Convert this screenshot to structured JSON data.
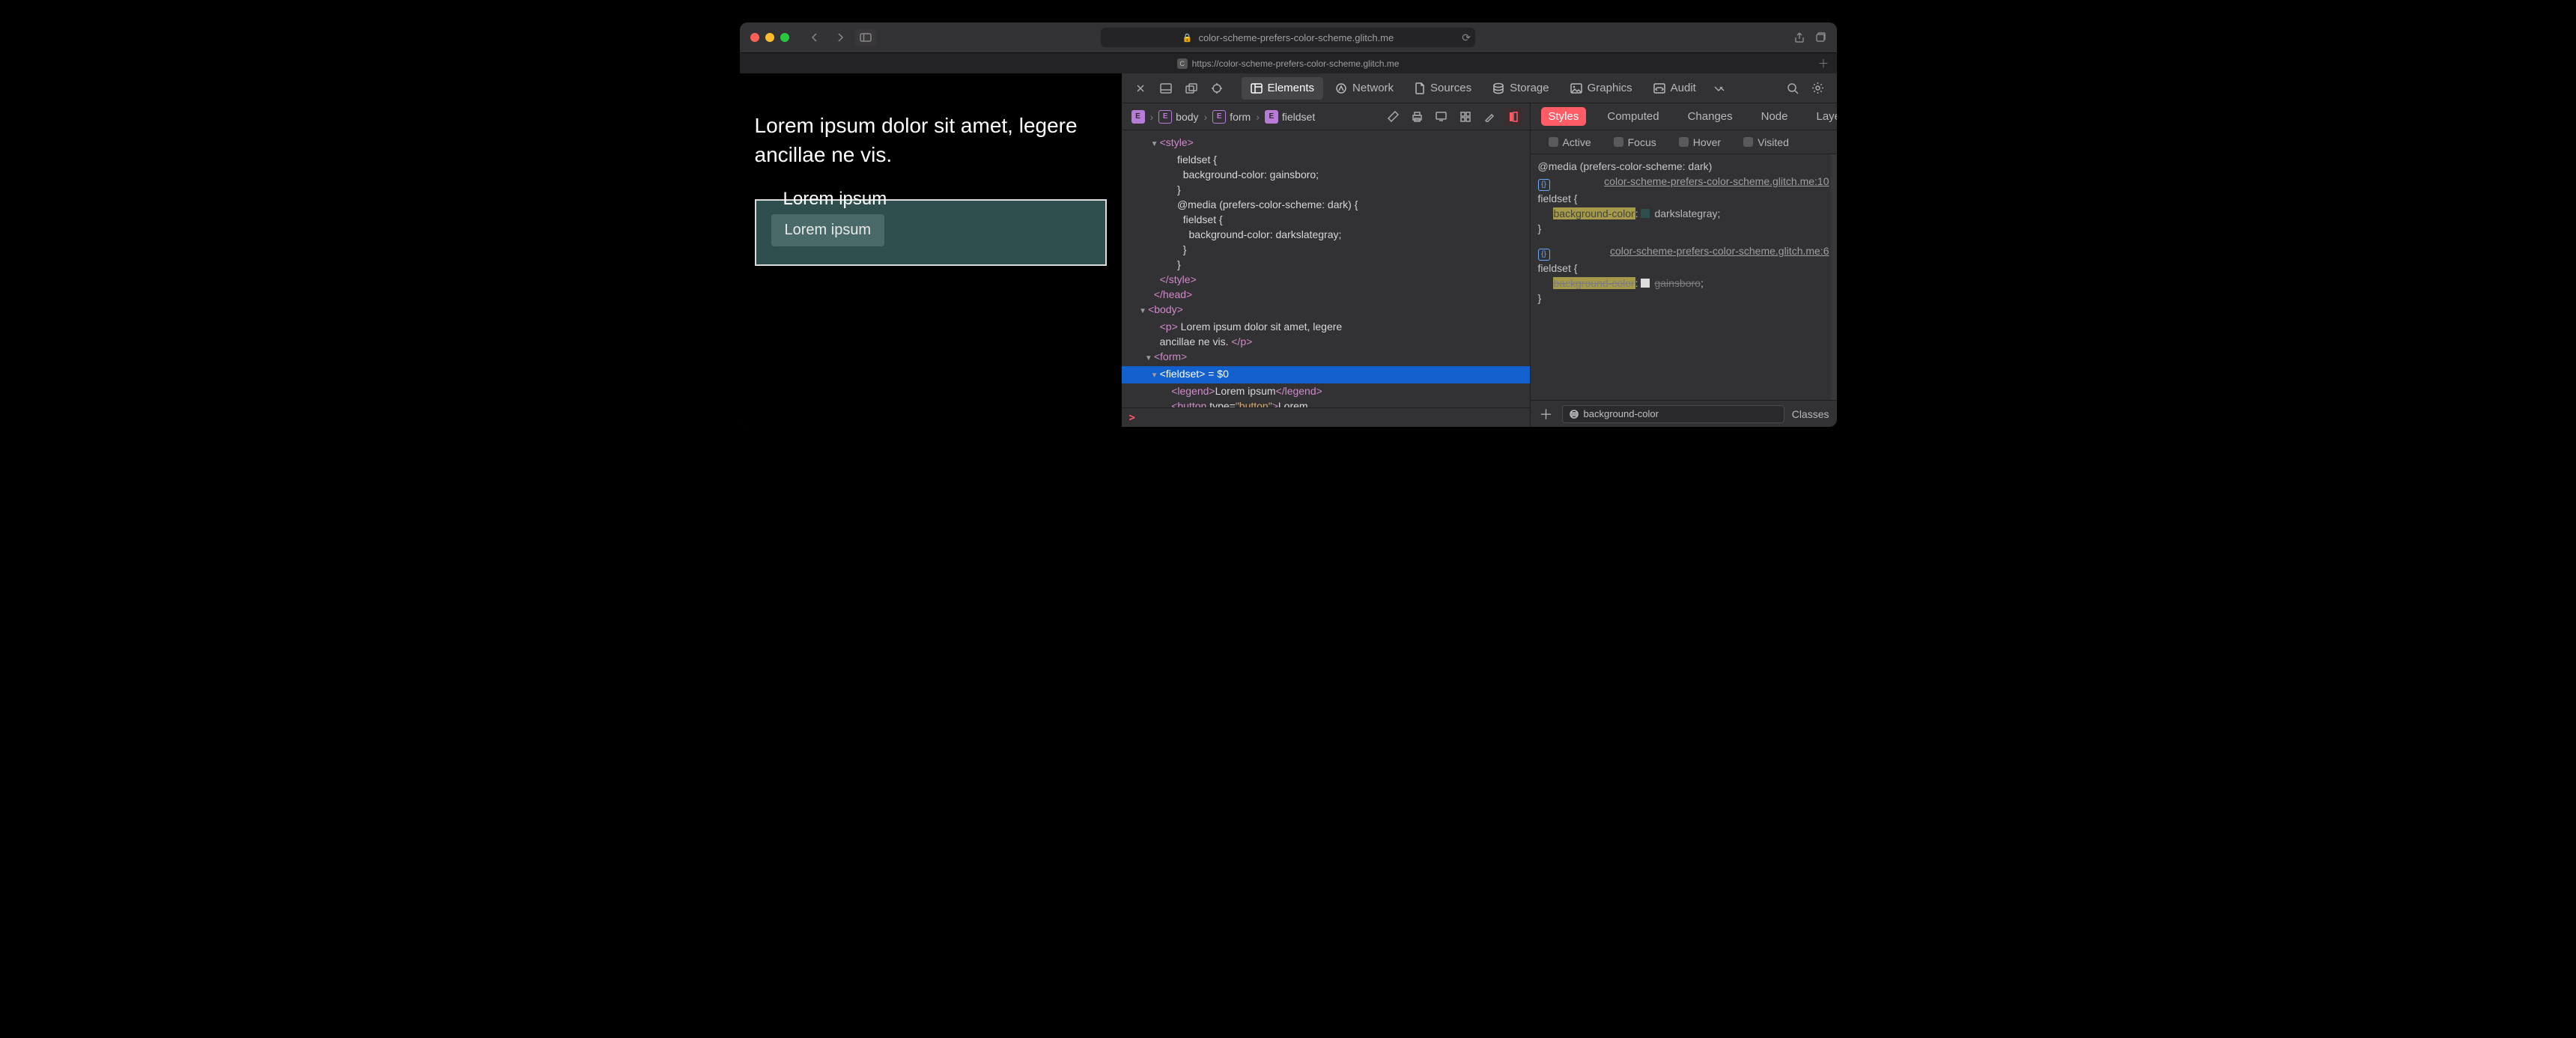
{
  "titlebar": {
    "address_host": "color-scheme-prefers-color-scheme.glitch.me"
  },
  "tabbar": {
    "url": "https://color-scheme-prefers-color-scheme.glitch.me",
    "favicon_letter": "C"
  },
  "page": {
    "paragraph": "Lorem ipsum dolor sit amet, legere ancillae ne vis.",
    "legend": "Lorem ipsum",
    "button": "Lorem ipsum"
  },
  "devtools": {
    "tabs": {
      "elements": "Elements",
      "network": "Network",
      "sources": "Sources",
      "storage": "Storage",
      "graphics": "Graphics",
      "audit": "Audit"
    },
    "breadcrumb": [
      "body",
      "form",
      "fieldset"
    ],
    "tree": {
      "lines": [
        {
          "indent": 5,
          "disclosure": "▼",
          "html": "<span class='tag'>&lt;style&gt;</span>"
        },
        {
          "indent": 8,
          "html": "<span class='txt'>fieldset {</span>"
        },
        {
          "indent": 9,
          "html": "<span class='txt'>background-color: gainsboro;</span>"
        },
        {
          "indent": 8,
          "html": "<span class='txt'>}</span>"
        },
        {
          "indent": 8,
          "html": "<span class='txt'>@media (prefers-color-scheme: dark) {</span>"
        },
        {
          "indent": 9,
          "html": "<span class='txt'>fieldset {</span>"
        },
        {
          "indent": 10,
          "html": "<span class='txt'>background-color: darkslategray;</span>"
        },
        {
          "indent": 9,
          "html": "<span class='txt'>}</span>"
        },
        {
          "indent": 8,
          "html": "<span class='txt'>}</span>"
        },
        {
          "indent": 5,
          "html": "<span class='tag'>&lt;/style&gt;</span>"
        },
        {
          "indent": 4,
          "html": "<span class='tag'>&lt;/head&gt;</span>"
        },
        {
          "indent": 3,
          "disclosure": "▼",
          "html": "<span class='tag'>&lt;body&gt;</span>"
        },
        {
          "indent": 5,
          "html": "<span class='tag'>&lt;p&gt;</span><span class='txt'> Lorem ipsum dolor sit amet, legere</span>"
        },
        {
          "indent": 5,
          "html": "<span class='txt'>ancillae ne vis. </span><span class='tag'>&lt;/p&gt;</span>"
        },
        {
          "indent": 4,
          "disclosure": "▼",
          "html": "<span class='tag'>&lt;form&gt;</span>"
        },
        {
          "indent": 5,
          "disclosure": "▼",
          "selected": true,
          "html": "<span class='tag'>&lt;fieldset&gt;</span><span class='txt'> = $0</span>"
        },
        {
          "indent": 7,
          "gutter": true,
          "html": "<span class='tag'>&lt;legend&gt;</span><span class='txt'>Lorem ipsum</span><span class='tag'>&lt;/legend&gt;</span>"
        },
        {
          "indent": 7,
          "gutter": true,
          "html": "<span class='tag'>&lt;button </span><span class='txt'>type=</span><span class='attr'>\"button\"</span><span class='tag'>&gt;</span><span class='txt'>Lorem</span>"
        }
      ]
    },
    "styles": {
      "tabs": {
        "styles": "Styles",
        "computed": "Computed",
        "changes": "Changes",
        "node": "Node",
        "layers": "Layers"
      },
      "pseudo": {
        "active": "Active",
        "focus": "Focus",
        "hover": "Hover",
        "visited": "Visited"
      },
      "rule1": {
        "media": "@media (prefers-color-scheme: dark)",
        "source": "color-scheme-prefers-color-scheme.glitch.me:10",
        "selector": "fieldset",
        "prop": "background-color",
        "val": "darkslategray"
      },
      "rule2": {
        "source": "color-scheme-prefers-color-scheme.glitch.me:6",
        "selector": "fieldset",
        "prop": "background-color",
        "val": "gainsboro"
      },
      "filter_value": "background-color",
      "classes_label": "Classes"
    }
  }
}
